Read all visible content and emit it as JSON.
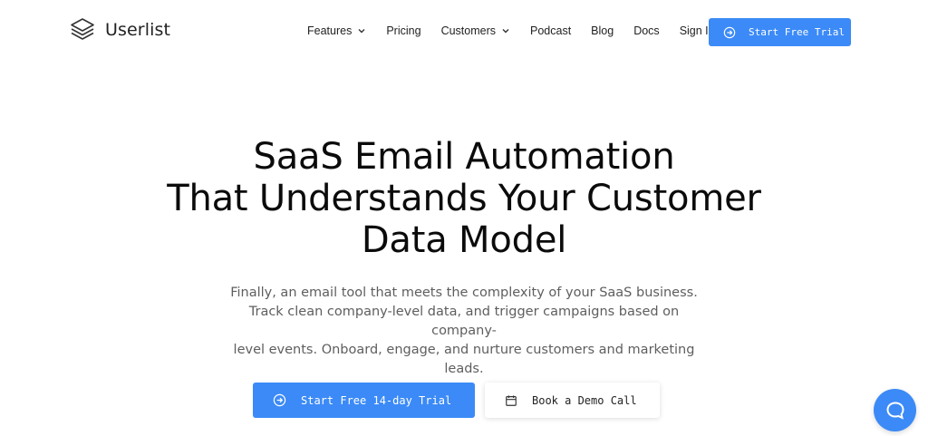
{
  "brand": {
    "name": "Userlist",
    "icon": "stacked-layers-icon"
  },
  "nav": {
    "items": [
      {
        "label": "Features",
        "has_dropdown": true
      },
      {
        "label": "Pricing",
        "has_dropdown": false
      },
      {
        "label": "Customers",
        "has_dropdown": true
      },
      {
        "label": "Podcast",
        "has_dropdown": false
      },
      {
        "label": "Blog",
        "has_dropdown": false
      },
      {
        "label": "Docs",
        "has_dropdown": false
      },
      {
        "label": "Sign In",
        "has_dropdown": false
      }
    ],
    "cta_label": "Start Free Trial",
    "cta_icon": "arrow-circle-right-icon"
  },
  "hero": {
    "title_lines": [
      "SaaS Email Automation",
      "That Understands Your Customer",
      "Data Model"
    ],
    "subtitle_lines": [
      "Finally, an email tool that meets the complexity of your SaaS business.",
      "Track clean company-level data, and trigger campaigns based on company-",
      "level events. Onboard, engage, and nurture customers and marketing leads."
    ],
    "primary_cta": {
      "label": "Start Free 14-day Trial",
      "icon": "arrow-circle-right-icon"
    },
    "secondary_cta": {
      "label": "Book a Demo Call",
      "icon": "calendar-icon"
    }
  },
  "chat": {
    "icon": "chat-bubble-icon"
  },
  "colors": {
    "accent": "#3b8af7",
    "text": "#0b0b0b",
    "muted": "#5e5e5e"
  }
}
